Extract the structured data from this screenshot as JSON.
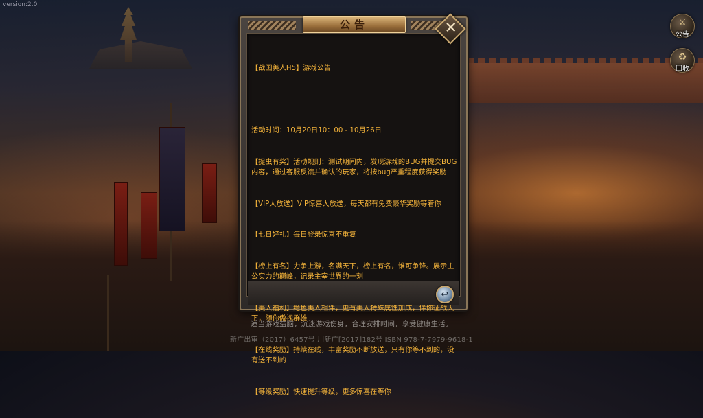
{
  "version": "version:2.0",
  "side_buttons": {
    "notice_label": "公告",
    "return_label": "回收"
  },
  "panel": {
    "title": "公告",
    "close_symbol": "✕",
    "back_symbol": "↩",
    "lines": [
      "【战国美人H5】游戏公告",
      "",
      "活动时间：10月20日10：00 - 10月26日",
      "【捉虫有奖】活动规则：测试期间内，发现游戏的BUG并提交BUG内容，通过客服反馈并确认的玩家，将按bug严重程度获得奖励",
      "【VIP大放送】VIP惊喜大放送，每天都有免费豪华奖励等着你",
      "【七日好礼】每日登录惊喜不重复",
      "【榜上有名】力争上游，名满天下，榜上有名，谁可争锋。展示主公实力的巅峰，记录主宰世界的一刻",
      "【美人福利】绝色美人相伴，更有美人特殊属性加成，伴你征战天下，随你傲视群雄",
      "【在线奖励】持续在线，丰富奖励不断放送，只有你等不到的，没有送不到的",
      "【等级奖励】快速提升等级，更多惊喜在等你"
    ]
  },
  "footer": {
    "health_notice": "适当游戏益脑，沉迷游戏伤身，合理安排时间，享受健康生活。",
    "isbn": "新广出审（2017）6457号 川新广[2017]182号 ISBN 978-7-7979-9618-1"
  },
  "colors": {
    "notice_text": "#f2b23a",
    "panel_border": "#8a7658",
    "title_bar": "#c79a5c"
  },
  "icons": [
    "close-icon",
    "back-arrow-icon",
    "notice-icon",
    "recycle-icon"
  ]
}
